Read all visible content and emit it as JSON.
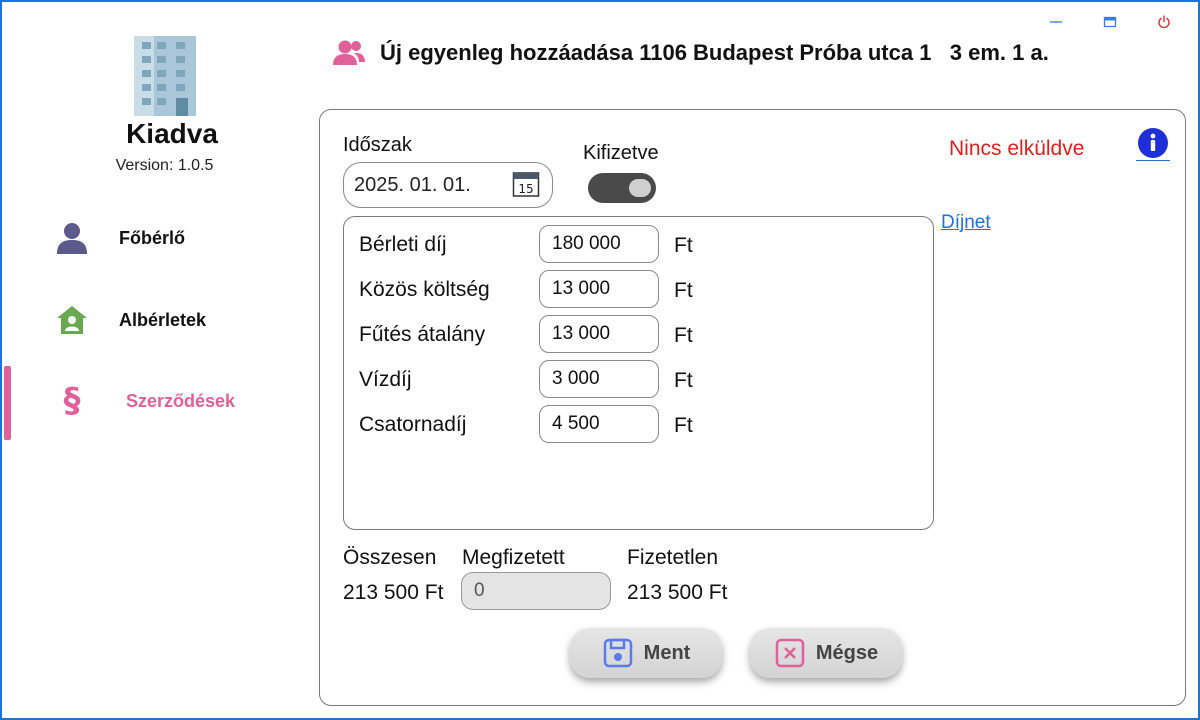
{
  "app": {
    "name": "Kiadva",
    "version": "Version: 1.0.5"
  },
  "sidebar": {
    "items": [
      {
        "label": "Főbérlő",
        "icon": "person-icon"
      },
      {
        "label": "Albérletek",
        "icon": "house-icon"
      },
      {
        "label": "Szerződések",
        "icon": "section-icon",
        "active": true
      }
    ]
  },
  "header": {
    "title": "Új egyenleg hozzáadása 1106 Budapest Próba utca 1   3 em. 1 a."
  },
  "form": {
    "period_label": "Időszak",
    "period_value": "2025. 01. 01.",
    "calendar_day": "15",
    "paid_toggle_label": "Kifizetve",
    "status": "Nincs elküldve",
    "link": "Díjnet",
    "fees": [
      {
        "label": "Bérleti díj",
        "value": "180 000",
        "unit": "Ft"
      },
      {
        "label": "Közös költség",
        "value": "13 000",
        "unit": "Ft"
      },
      {
        "label": "Fűtés átalány",
        "value": "13 000",
        "unit": "Ft"
      },
      {
        "label": "Vízdíj",
        "value": "3 000",
        "unit": "Ft"
      },
      {
        "label": "Csatornadíj",
        "value": "4 500",
        "unit": "Ft"
      }
    ],
    "total_label": "Összesen",
    "total_value": "213 500 Ft",
    "paid_label": "Megfizetett",
    "paid_value": "0",
    "unpaid_label": "Fizetetlen",
    "unpaid_value": "213 500 Ft"
  },
  "actions": {
    "save_label": "Ment",
    "cancel_label": "Mégse"
  },
  "colors": {
    "accent": "#e0609a",
    "status": "#e02020",
    "link": "#1e73d8",
    "primary": "#1e73d8"
  }
}
